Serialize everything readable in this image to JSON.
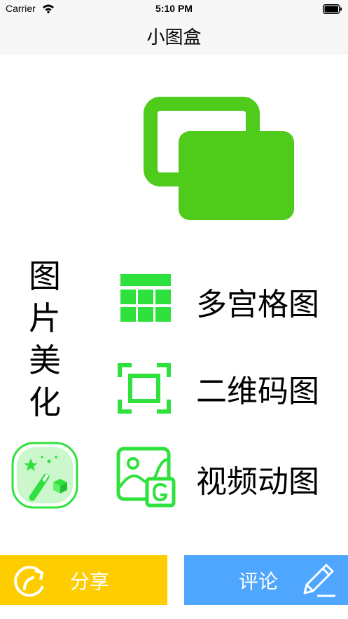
{
  "status_bar": {
    "carrier": "Carrier",
    "time": "5:10 PM",
    "icons": [
      "wifi-icon",
      "battery-icon"
    ]
  },
  "nav": {
    "title": "小图盒"
  },
  "hero": {
    "icon": "windows-icon",
    "color": "#4fcb1c"
  },
  "section": {
    "title_chars": [
      "图",
      "片",
      "美",
      "化"
    ],
    "icon": "magic-wand-icon"
  },
  "menu": [
    {
      "label": "多宫格图",
      "icon": "grid-icon"
    },
    {
      "label": "二维码图",
      "icon": "scan-frame-icon"
    },
    {
      "label": "视频动图",
      "icon": "gif-image-icon"
    }
  ],
  "footer": {
    "share_label": "分享",
    "share_icon": "share-arrow-icon",
    "comment_label": "评论",
    "comment_icon": "pencil-icon"
  },
  "colors": {
    "accent_green": "#4fcb1c",
    "menu_green": "#2fe13c",
    "share_bg": "#fecd00",
    "comment_bg": "#4fa6ff"
  }
}
